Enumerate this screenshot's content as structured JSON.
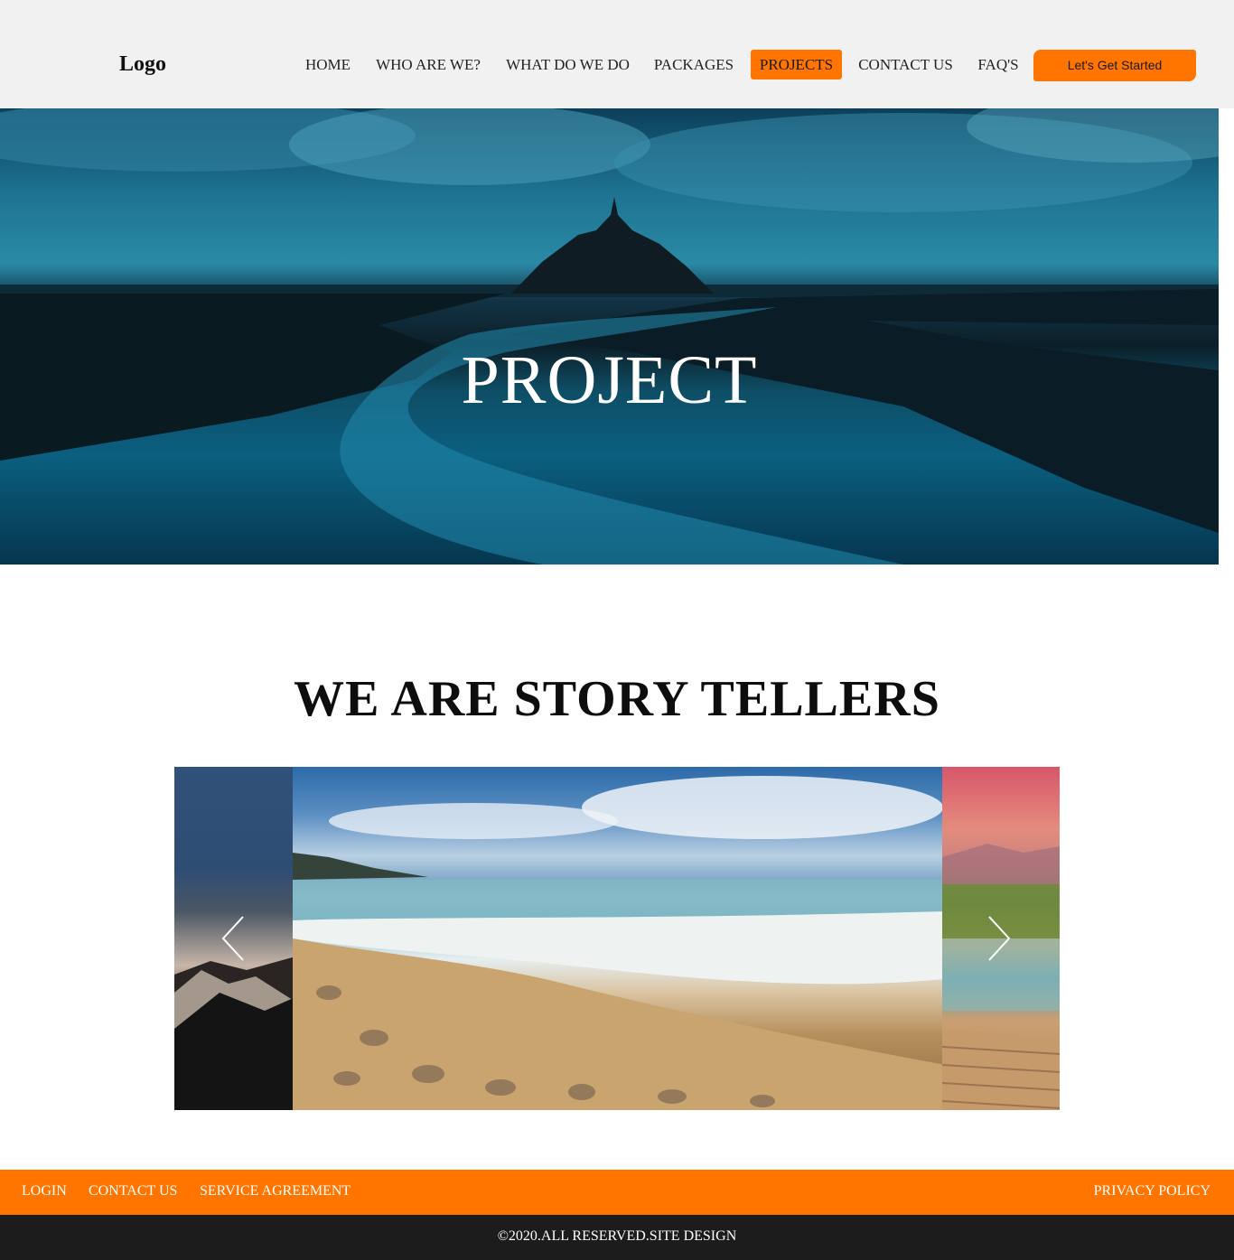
{
  "header": {
    "logo": "Logo",
    "nav": [
      {
        "label": "HOME",
        "active": false
      },
      {
        "label": "WHO ARE WE?",
        "active": false
      },
      {
        "label": "WHAT DO WE DO",
        "active": false
      },
      {
        "label": "PACKAGES",
        "active": false
      },
      {
        "label": "PROJECTS",
        "active": true
      },
      {
        "label": "CONTACT US",
        "active": false
      },
      {
        "label": "FAQ'S",
        "active": false
      }
    ],
    "cta_label": "Let's Get Started"
  },
  "hero": {
    "title": "PROJECT"
  },
  "section": {
    "title": "WE ARE STORY TELLERS"
  },
  "carousel": {
    "prev_icon": "chevron-left-icon",
    "next_icon": "chevron-right-icon"
  },
  "footer": {
    "links": [
      "LOGIN",
      "CONTACT US",
      "SERVICE AGREEMENT"
    ],
    "privacy": "PRIVACY POLICY",
    "copyright": "©2020.ALL RESERVED.SITE DESIGN"
  },
  "colors": {
    "accent": "#ff7500",
    "header_bg": "#f1f1f1",
    "copyright_bg": "#1c1c1c"
  }
}
